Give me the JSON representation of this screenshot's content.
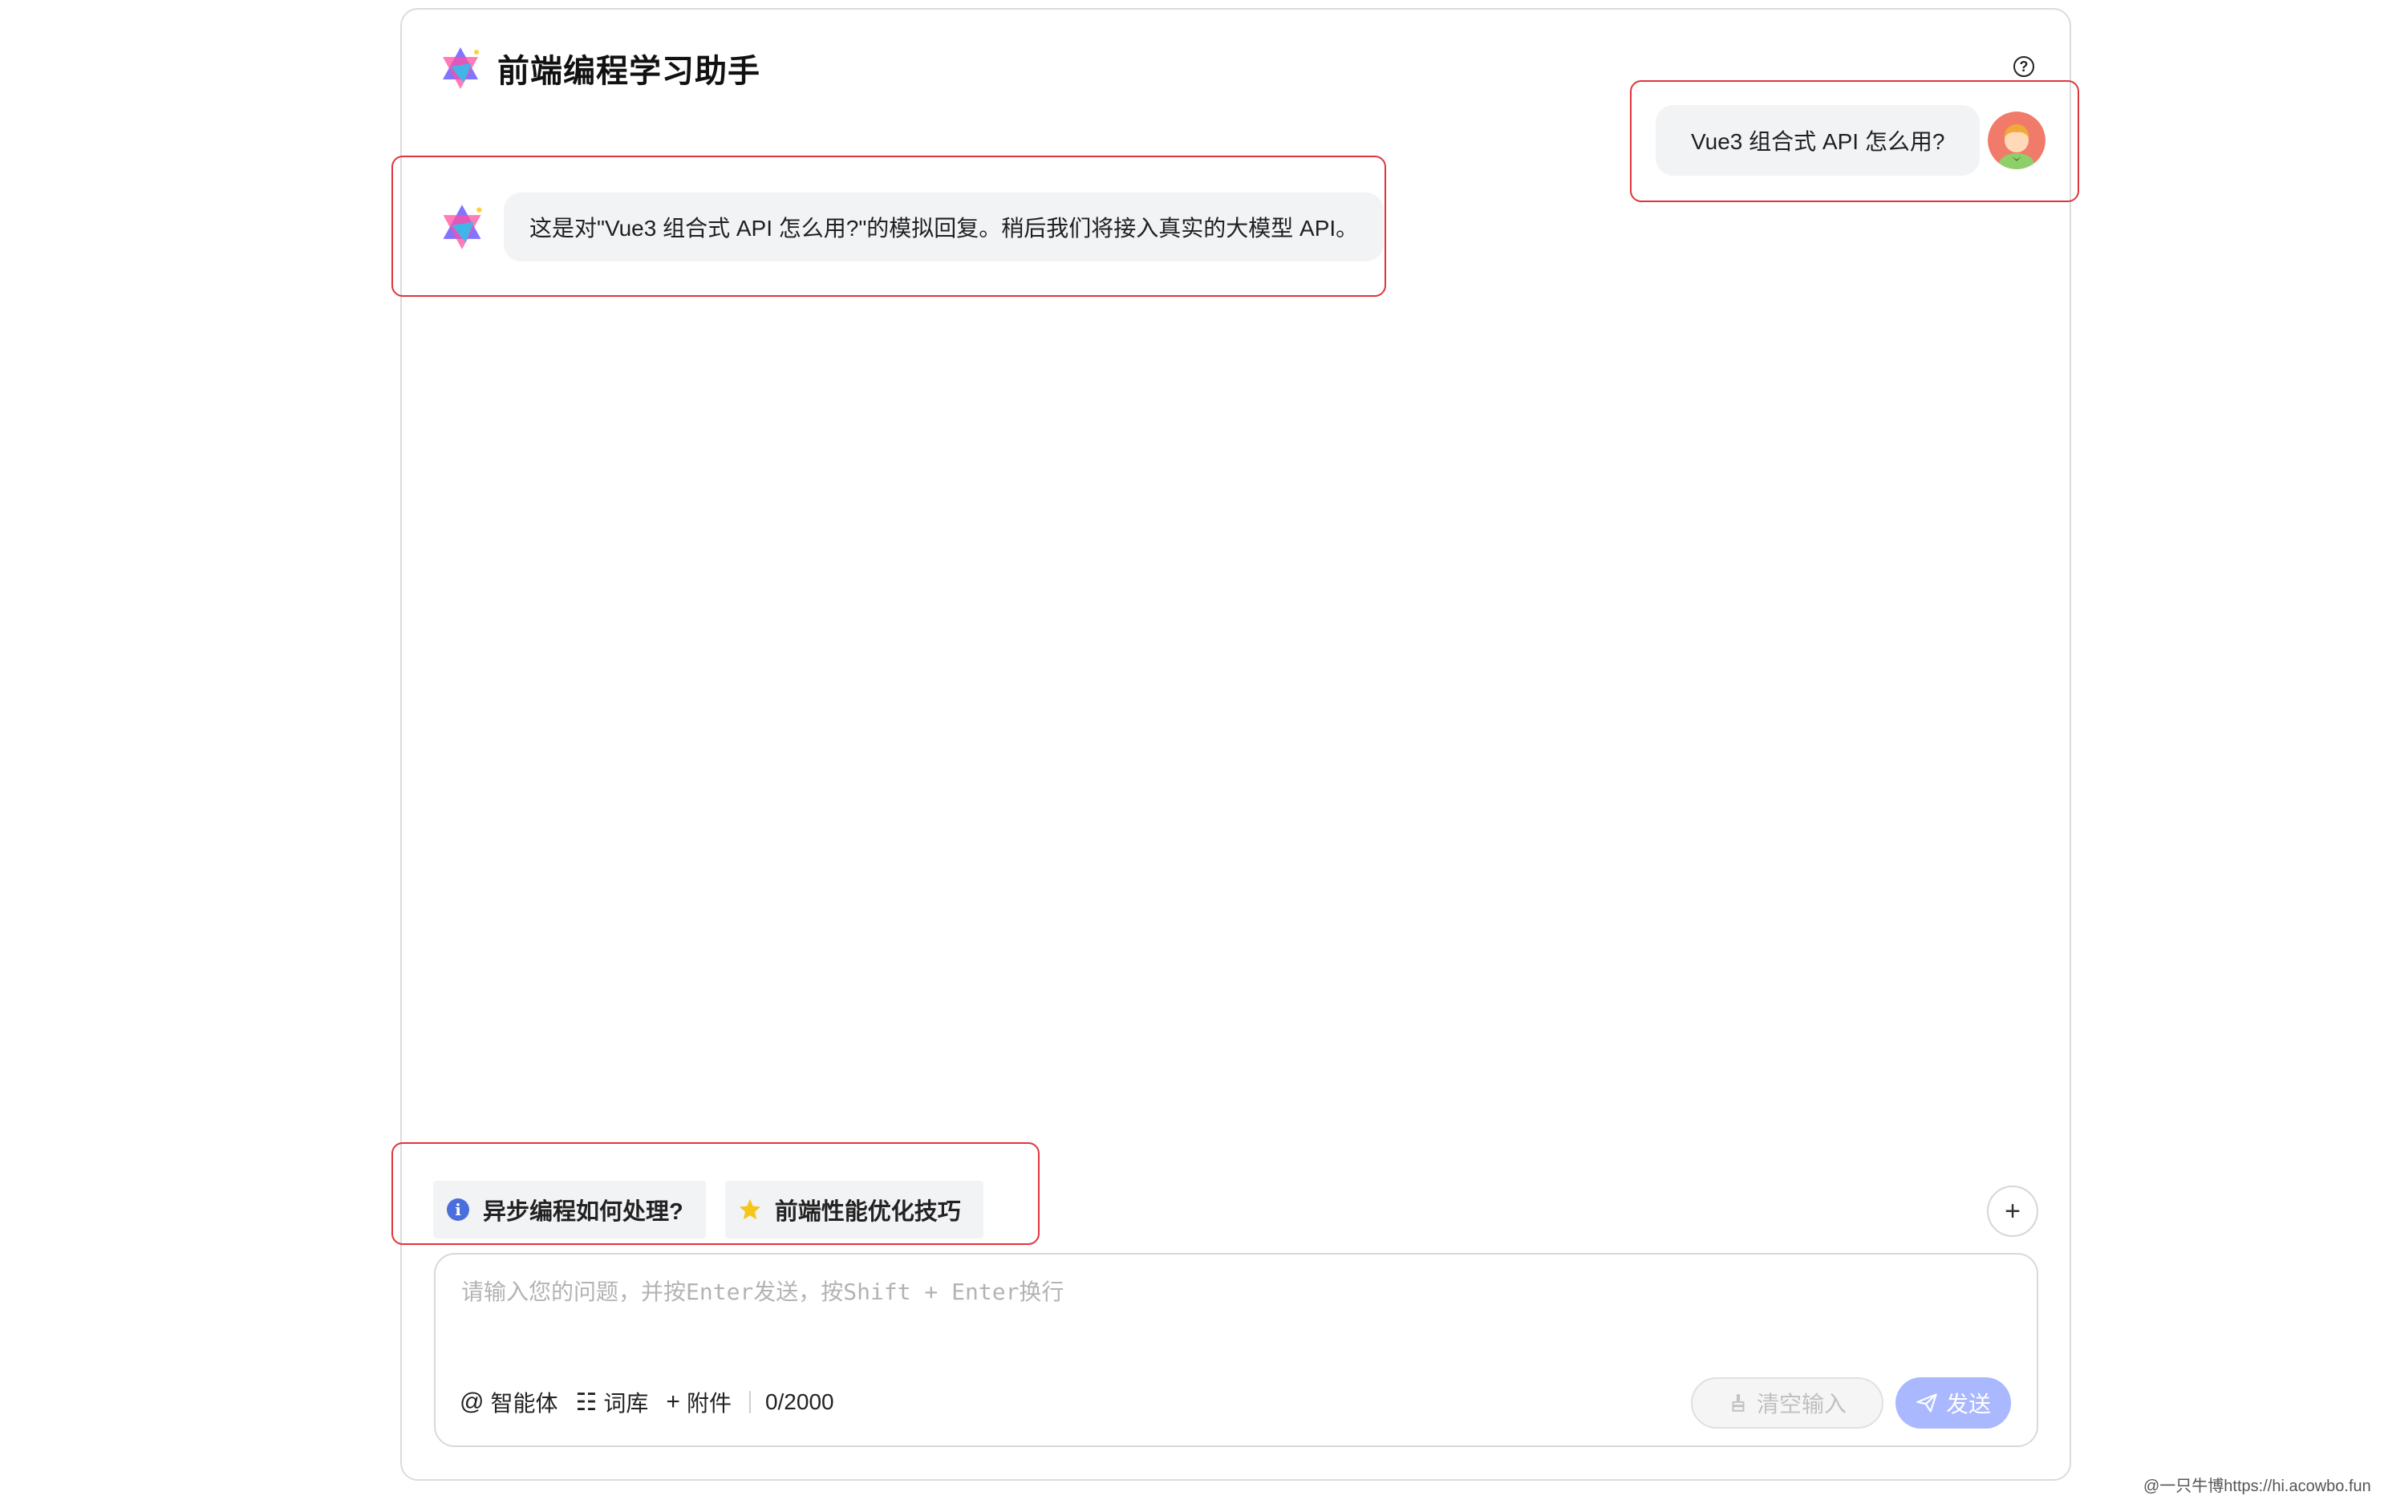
{
  "header": {
    "title": "前端编程学习助手",
    "help_icon": "question-circle-icon",
    "help_glyph": "?"
  },
  "messages": {
    "user": {
      "text": "Vue3 组合式 API 怎么用?"
    },
    "assistant": {
      "text": "这是对\"Vue3 组合式 API 怎么用?\"的模拟回复。稍后我们将接入真实的大模型 API。"
    }
  },
  "prompts": [
    {
      "label": "异步编程如何处理?",
      "icon": "info-icon",
      "glyph": "i"
    },
    {
      "label": "前端性能优化技巧",
      "icon": "star-icon"
    }
  ],
  "add_button": {
    "glyph": "+"
  },
  "input": {
    "placeholder": "请输入您的问题，并按Enter发送，按Shift + Enter换行",
    "value": ""
  },
  "tools": {
    "agent": {
      "icon_glyph": "@",
      "label": "智能体"
    },
    "library": {
      "icon_glyph": "☷",
      "label": "词库"
    },
    "attachment": {
      "icon_glyph": "+",
      "label": "附件"
    },
    "counter": "0/2000"
  },
  "buttons": {
    "clear": "清空输入",
    "send": "发送"
  },
  "watermark": "@一只牛博https://hi.acowbo.fun",
  "colors": {
    "annotation": "#e0343c",
    "send": "#a9b8ff",
    "bubble": "#f2f3f5",
    "info": "#4a6fdc",
    "star": "#f5c518"
  }
}
